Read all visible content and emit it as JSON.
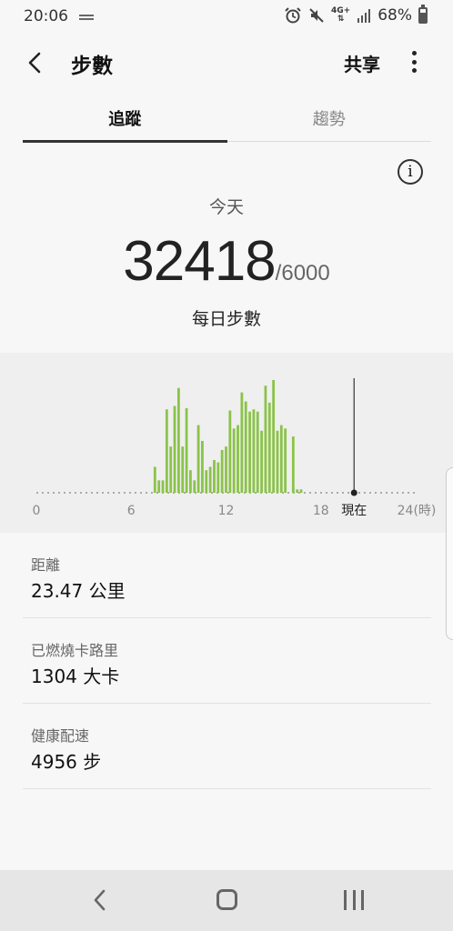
{
  "status_bar": {
    "time": "20:06",
    "network": "4G+",
    "battery": "68%"
  },
  "app_bar": {
    "title": "步數",
    "share_label": "共享"
  },
  "tabs": [
    {
      "label": "追蹤",
      "active": true
    },
    {
      "label": "趨勢",
      "active": false
    }
  ],
  "summary": {
    "period_label": "今天",
    "steps": "32418",
    "goal": "/6000",
    "steps_caption": "每日步數"
  },
  "chart_data": {
    "type": "bar",
    "x_ticks": [
      {
        "label": "0",
        "hour": 0
      },
      {
        "label": "6",
        "hour": 6
      },
      {
        "label": "12",
        "hour": 12
      },
      {
        "label": "18",
        "hour": 18
      },
      {
        "label": "現在",
        "hour": 20.1
      },
      {
        "label": "24(時)",
        "hour": 24
      }
    ],
    "now_hour": 20.1,
    "bar_color": "#8bc34a",
    "values": [
      0,
      0,
      0,
      0,
      0,
      0,
      0,
      0,
      0,
      0,
      0,
      0,
      0,
      0,
      0,
      0,
      0,
      0,
      0,
      0,
      0,
      0,
      0,
      0,
      0,
      0,
      0,
      0,
      0,
      0,
      0,
      0,
      0,
      0,
      0,
      0,
      0,
      0,
      0,
      0,
      0,
      0,
      0,
      0,
      0,
      0,
      0,
      0,
      0,
      0,
      0,
      0,
      0,
      0,
      0,
      0,
      0,
      0,
      0,
      0,
      0,
      0,
      0,
      0,
      0,
      0,
      0,
      0,
      0,
      0,
      0,
      0,
      0,
      0,
      0,
      0,
      0,
      0,
      0,
      0,
      0,
      0,
      0,
      0,
      0,
      0,
      0,
      0,
      0,
      0,
      0,
      0,
      0,
      0,
      0,
      0,
      0,
      0,
      0,
      0,
      0,
      0,
      0,
      0,
      0,
      0,
      0,
      0,
      0,
      0,
      0,
      0,
      0,
      0,
      0,
      0,
      0,
      0,
      0,
      0,
      0,
      0,
      0,
      0,
      0,
      0,
      0,
      0,
      0,
      0,
      0,
      0,
      0,
      0,
      0,
      0,
      0,
      0,
      0,
      0,
      0,
      0,
      0,
      0,
      0,
      0,
      0,
      0,
      0,
      0,
      0,
      0,
      0,
      0,
      0,
      0,
      0,
      0,
      0,
      0,
      0,
      0,
      0,
      0,
      0,
      0,
      0,
      0,
      0,
      0,
      0,
      0,
      0,
      0,
      0,
      0,
      0,
      0,
      0,
      0,
      0,
      0,
      0,
      0,
      0,
      0,
      0,
      0,
      0,
      0,
      0,
      0,
      0,
      0,
      0,
      0,
      0,
      0,
      0,
      0,
      0,
      0,
      0,
      0,
      0,
      0,
      0,
      0,
      0,
      0,
      0,
      0,
      0,
      0,
      0,
      0
    ],
    "bars": [
      {
        "hour": 7.5,
        "value": 0.23
      },
      {
        "hour": 7.75,
        "value": 0.11
      },
      {
        "hour": 8.0,
        "value": 0.11
      },
      {
        "hour": 8.25,
        "value": 0.74
      },
      {
        "hour": 8.5,
        "value": 0.41
      },
      {
        "hour": 8.75,
        "value": 0.77
      },
      {
        "hour": 9.0,
        "value": 0.93
      },
      {
        "hour": 9.25,
        "value": 0.41
      },
      {
        "hour": 9.5,
        "value": 0.75
      },
      {
        "hour": 9.75,
        "value": 0.2
      },
      {
        "hour": 10.0,
        "value": 0.11
      },
      {
        "hour": 10.25,
        "value": 0.6
      },
      {
        "hour": 10.5,
        "value": 0.46
      },
      {
        "hour": 10.75,
        "value": 0.2
      },
      {
        "hour": 11.0,
        "value": 0.23
      },
      {
        "hour": 11.25,
        "value": 0.29
      },
      {
        "hour": 11.5,
        "value": 0.27
      },
      {
        "hour": 11.75,
        "value": 0.38
      },
      {
        "hour": 12.0,
        "value": 0.41
      },
      {
        "hour": 12.25,
        "value": 0.73
      },
      {
        "hour": 12.5,
        "value": 0.57
      },
      {
        "hour": 12.75,
        "value": 0.6
      },
      {
        "hour": 13.0,
        "value": 0.89
      },
      {
        "hour": 13.25,
        "value": 0.81
      },
      {
        "hour": 13.5,
        "value": 0.72
      },
      {
        "hour": 13.75,
        "value": 0.74
      },
      {
        "hour": 14.0,
        "value": 0.72
      },
      {
        "hour": 14.25,
        "value": 0.55
      },
      {
        "hour": 14.5,
        "value": 0.95
      },
      {
        "hour": 14.75,
        "value": 0.8
      },
      {
        "hour": 15.0,
        "value": 1.0
      },
      {
        "hour": 15.25,
        "value": 0.55
      },
      {
        "hour": 15.5,
        "value": 0.6
      },
      {
        "hour": 15.75,
        "value": 0.57
      },
      {
        "hour": 16.25,
        "value": 0.5
      },
      {
        "hour": 16.5,
        "value": 0.03
      },
      {
        "hour": 16.75,
        "value": 0.03
      }
    ],
    "xlim": [
      0,
      24
    ]
  },
  "stats": [
    {
      "label": "距離",
      "value": "23.47 公里"
    },
    {
      "label": "已燃燒卡路里",
      "value": "1304 大卡"
    },
    {
      "label": "健康配速",
      "value": "4956 步"
    }
  ]
}
